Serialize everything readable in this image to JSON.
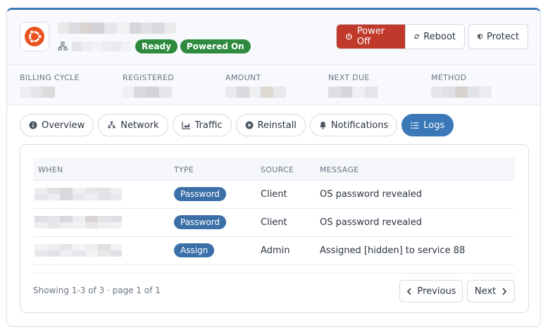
{
  "header": {
    "badges": [
      "Ready",
      "Powered On"
    ],
    "actions": {
      "power_off": "Power Off",
      "reboot": "Reboot",
      "protect": "Protect"
    }
  },
  "info": {
    "labels": [
      "BILLING CYCLE",
      "REGISTERED",
      "AMOUNT",
      "NEXT DUE",
      "METHOD"
    ]
  },
  "tabs": [
    {
      "label": "Overview",
      "icon": "info-icon"
    },
    {
      "label": "Network",
      "icon": "network-icon"
    },
    {
      "label": "Traffic",
      "icon": "chart-icon"
    },
    {
      "label": "Reinstall",
      "icon": "disc-icon"
    },
    {
      "label": "Notifications",
      "icon": "bell-icon"
    },
    {
      "label": "Logs",
      "icon": "list-icon",
      "active": true
    }
  ],
  "logs": {
    "columns": [
      "WHEN",
      "TYPE",
      "SOURCE",
      "MESSAGE"
    ],
    "rows": [
      {
        "type": "Password",
        "source": "Client",
        "message": "OS password revealed"
      },
      {
        "type": "Password",
        "source": "Client",
        "message": "OS password revealed"
      },
      {
        "type": "Assign",
        "source": "Admin",
        "message": "Assigned [hidden] to service 88"
      }
    ],
    "summary": "Showing 1-3 of 3 · page 1 of 1",
    "prev_label": "Previous",
    "next_label": "Next"
  },
  "colors": {
    "accent": "#3a78b8",
    "danger": "#c0392b",
    "success": "#2e8b3e",
    "ubuntu": "#e95420"
  }
}
